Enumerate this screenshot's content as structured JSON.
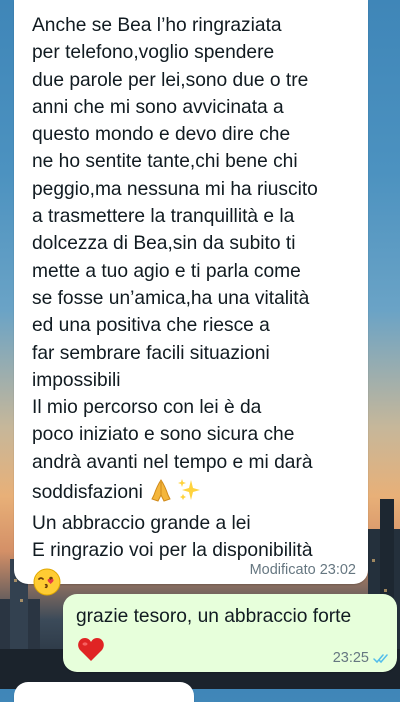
{
  "chat": {
    "incoming_message": {
      "lines": [
        "Anche se Bea l’ho ringraziata",
        "per telefono,voglio spendere",
        "due parole per lei,sono due o tre",
        "anni che mi sono avvicinata a",
        "questo mondo e devo dire che",
        "ne ho sentite tante,chi bene chi",
        "peggio,ma nessuna mi ha riuscito",
        "a trasmettere la tranquillità e la",
        "dolcezza di Bea,sin da subito ti",
        "mette a tuo agio e ti parla come",
        "se fosse un’amica,ha una vitalità",
        "ed una positiva che riesce a",
        "far sembrare facili situazioni",
        "impossibili",
        "Il mio percorso con lei è da",
        "poco iniziato e sono sicura che",
        "andrà avanti nel tempo e mi darà",
        "soddisfazioni"
      ],
      "closing_lines": [
        "Un abbraccio grande a lei",
        "E ringrazio voi per la disponibilità"
      ],
      "emojis": [
        "folded-hands-emoji",
        "sparkles-emoji",
        "face-blowing-kiss-emoji"
      ],
      "status": "Modificato 23:02"
    },
    "outgoing_message": {
      "text": "grazie tesoro, un abbraccio forte",
      "emoji": "red-heart-emoji",
      "time": "23:25",
      "read_receipt": "double-check-read"
    }
  },
  "colors": {
    "incoming_bubble": "#ffffff",
    "outgoing_bubble": "#e7ffdb",
    "text": "#111b21",
    "meta_text": "#667781",
    "read_ticks": "#53bdeb"
  }
}
